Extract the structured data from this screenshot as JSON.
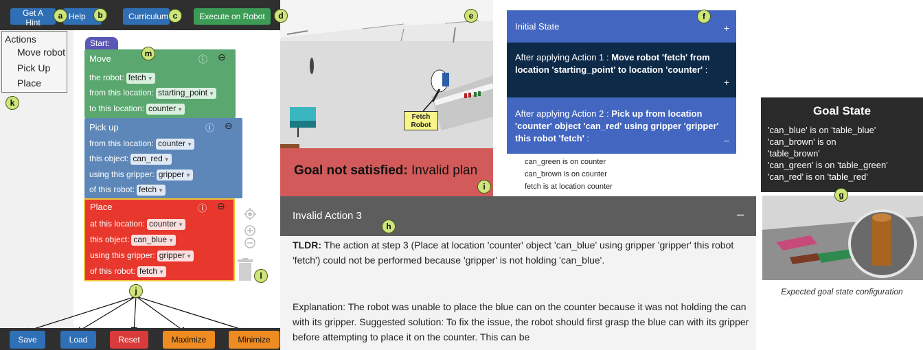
{
  "toolbar": {
    "hint_label": "Get A Hint",
    "help_label": "Help",
    "curriculum_label": "Curriculum",
    "execute_label": "Execute on Robot"
  },
  "actions_menu": {
    "title": "Actions",
    "items": [
      "Move robot",
      "Pick Up",
      "Place"
    ]
  },
  "program": {
    "start_label": "Start:",
    "blocks": [
      {
        "title": "Move",
        "color": "#5aa86f",
        "rows": [
          {
            "label": "the robot:",
            "value": "fetch"
          },
          {
            "label": "from this location:",
            "value": "starting_point"
          },
          {
            "label": "to this location:",
            "value": "counter"
          }
        ]
      },
      {
        "title": "Pick up",
        "color": "#5d87b8",
        "rows": [
          {
            "label": "from this location:",
            "value": "counter"
          },
          {
            "label": "this object:",
            "value": "can_red"
          },
          {
            "label": "using this gripper:",
            "value": "gripper"
          },
          {
            "label": "of this robot:",
            "value": "fetch"
          }
        ]
      },
      {
        "title": "Place",
        "color": "#e8372c",
        "rows": [
          {
            "label": "at this location:",
            "value": "counter"
          },
          {
            "label": "this object:",
            "value": "can_blue"
          },
          {
            "label": "using this gripper:",
            "value": "gripper"
          },
          {
            "label": "of this robot:",
            "value": "fetch"
          }
        ]
      }
    ],
    "info_glyph": "ⓘ",
    "collapse_glyph": "⊖"
  },
  "bottom_buttons": {
    "save": "Save",
    "load": "Load",
    "reset": "Reset",
    "maximize": "Maximize",
    "minimize": "Minimize"
  },
  "markers": {
    "a": "a",
    "b": "b",
    "c": "c",
    "d": "d",
    "e": "e",
    "f": "f",
    "g": "g",
    "h": "h",
    "i": "i",
    "j": "j",
    "k": "k",
    "l": "l",
    "m": "m"
  },
  "simulation": {
    "robot_label_line1": "Fetch",
    "robot_label_line2": "Robot",
    "goal_bold": "Goal not satisfied:",
    "goal_rest": " Invalid plan"
  },
  "state_panel": {
    "initial_label": "Initial State",
    "action1_prefix": "After applying Action 1 : ",
    "action1_bold": "Move robot 'fetch' from location 'starting_point' to location 'counter'",
    "action1_suffix": " :",
    "action2_prefix": "After applying Action 2 : ",
    "action2_bold": "Pick up from location 'counter' object 'can_red' using gripper 'gripper' this robot 'fetch'",
    "action2_suffix": " :",
    "plus": "+",
    "minus": "–",
    "facts": [
      "can_green is on counter",
      "can_brown is on counter",
      "fetch is at location counter"
    ],
    "colors": {
      "initial": "#4366c0",
      "action1": "#0d2a48",
      "action2": "#4366c0"
    }
  },
  "invalid_action": {
    "title": "Invalid Action 3",
    "collapse": "–",
    "tldr_label": "TLDR:",
    "tldr_text": " The action at step 3 (Place at location 'counter' object 'can_blue' using gripper 'gripper' this robot 'fetch') could not be performed because 'gripper' is not holding 'can_blue'.",
    "explanation": "Explanation: The robot was unable to place the blue can on the counter because it was not holding the can with its gripper. Suggested solution: To fix the issue, the robot should first grasp the blue can with its gripper before attempting to place it on the counter. This can be"
  },
  "goal_state": {
    "title": "Goal State",
    "lines": [
      "'can_blue' is on 'table_blue'",
      "'can_brown' is on",
      "'table_brown'",
      "'can_green' is on 'table_green'",
      "'can_red' is on 'table_red'"
    ],
    "caption": "Expected goal state configuration"
  }
}
